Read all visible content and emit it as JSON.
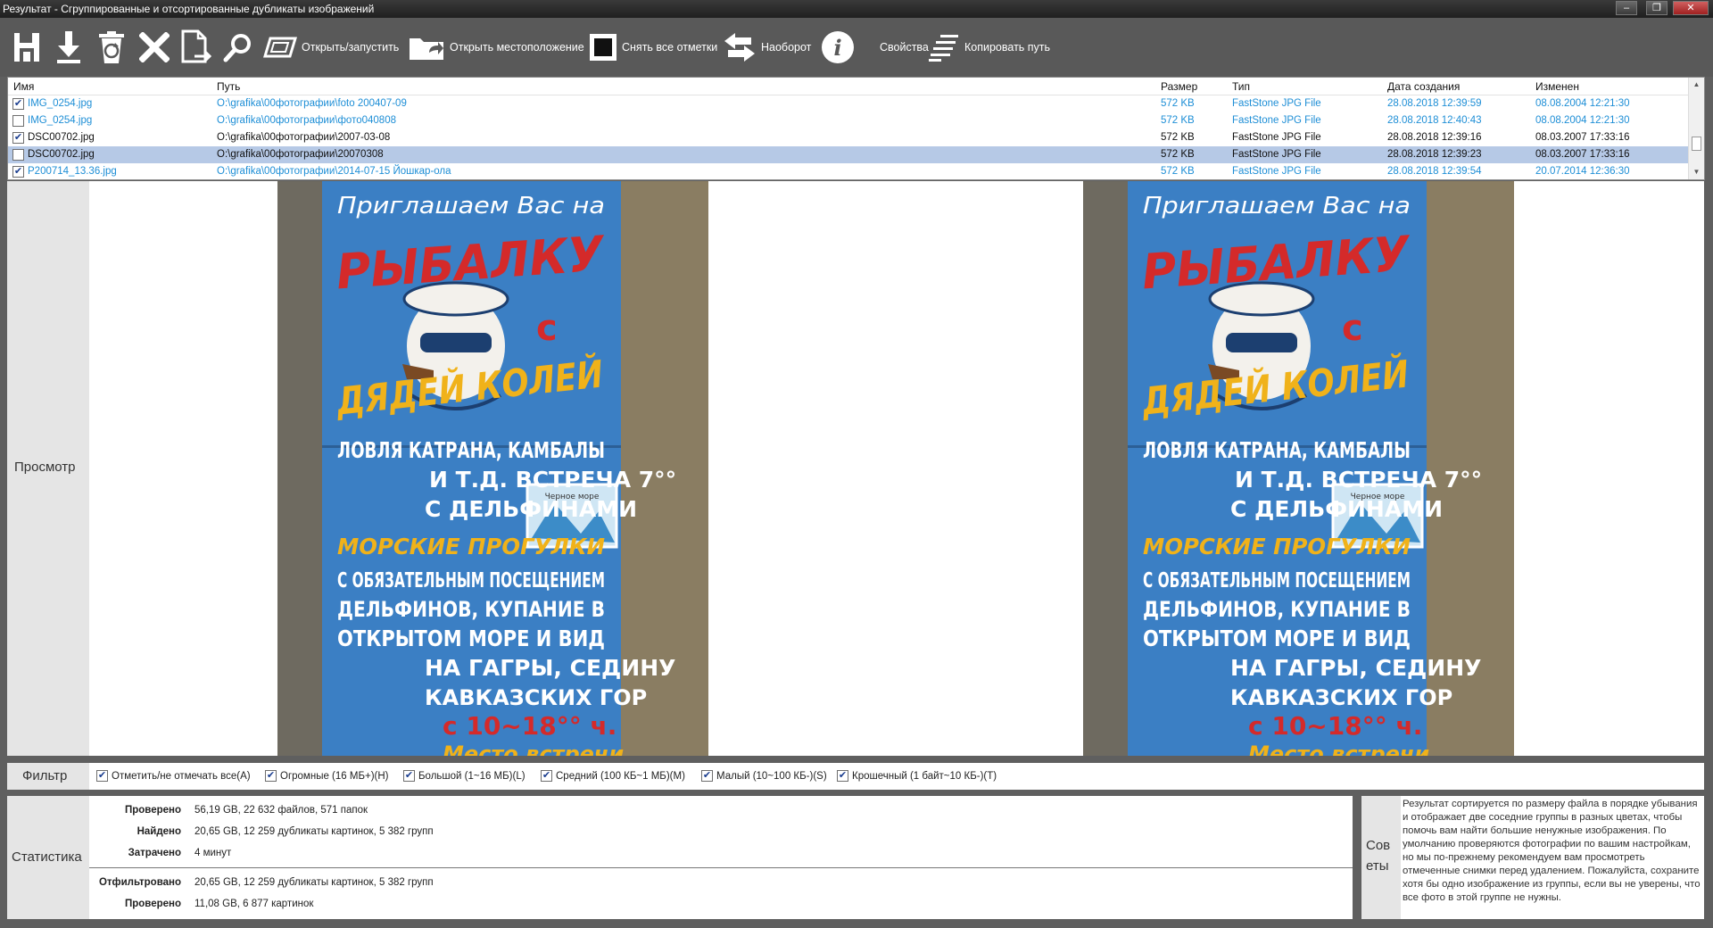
{
  "window": {
    "title": "Результат - Сгруппированные и отсортированные дубликаты изображений",
    "controls": [
      "‒",
      "❐",
      "✕"
    ]
  },
  "toolbar": {
    "buttons": [
      {
        "icon": "save-icon",
        "label": ""
      },
      {
        "icon": "download-icon",
        "label": ""
      },
      {
        "icon": "recycle-bin-icon",
        "label": ""
      },
      {
        "icon": "delete-x-icon",
        "label": ""
      },
      {
        "icon": "move-file-icon",
        "label": ""
      },
      {
        "icon": "search-icon",
        "label": ""
      },
      {
        "icon": "open-run-icon",
        "label": "Открыть/запустить"
      },
      {
        "icon": "folder-open-icon",
        "label": "Открыть местоположение"
      },
      {
        "icon": "uncheck-all-icon",
        "label": "Снять все отметки"
      },
      {
        "icon": "invert-arrows-icon",
        "label": "Наоборот"
      },
      {
        "icon": "info-icon",
        "label": "Свойства"
      },
      {
        "icon": "copy-path-icon",
        "label": "Копировать путь"
      }
    ]
  },
  "table": {
    "columns": [
      "Имя",
      "Путь",
      "Размер",
      "Тип",
      "Дата создания",
      "Изменен"
    ],
    "rows": [
      {
        "checked": true,
        "style": "blue",
        "selected": false,
        "name": "IMG_0254.jpg",
        "path": "O:\\grafika\\00фотографии\\foto 200407-09",
        "size": "572 KB",
        "type": "FastStone JPG File",
        "created": "28.08.2018 12:39:59",
        "modified": "08.08.2004 12:21:30"
      },
      {
        "checked": false,
        "style": "blue",
        "selected": false,
        "name": "IMG_0254.jpg",
        "path": "O:\\grafika\\00фотографии\\фото040808",
        "size": "572 KB",
        "type": "FastStone JPG File",
        "created": "28.08.2018 12:40:43",
        "modified": "08.08.2004 12:21:30"
      },
      {
        "checked": true,
        "style": "black",
        "selected": false,
        "name": "DSC00702.jpg",
        "path": "O:\\grafika\\00фотографии\\2007-03-08",
        "size": "572 KB",
        "type": "FastStone JPG File",
        "created": "28.08.2018 12:39:16",
        "modified": "08.03.2007 17:33:16"
      },
      {
        "checked": false,
        "style": "black",
        "selected": true,
        "name": "DSC00702.jpg",
        "path": "O:\\grafika\\00фотографии\\20070308",
        "size": "572 KB",
        "type": "FastStone JPG File",
        "created": "28.08.2018 12:39:23",
        "modified": "08.03.2007 17:33:16"
      },
      {
        "checked": true,
        "style": "blue",
        "selected": false,
        "name": "P200714_13.36.jpg",
        "path": "O:\\grafika\\00фотографии\\2014-07-15 Йошкар-ола",
        "size": "572 KB",
        "type": "FastStone JPG File",
        "created": "28.08.2018 12:39:54",
        "modified": "20.07.2014 12:36:30"
      }
    ]
  },
  "preview": {
    "label": "Просмотр",
    "sign": {
      "line1": "Приглашаем Вас на",
      "line2": "РЫБАЛКУ",
      "line3": "с",
      "line4": "ДЯДЕЙ КОЛЕЙ",
      "line5": "ЛОВЛЯ КАТРАНА, КАМБАЛЫ",
      "line6": "И Т.Д. ВСТРЕЧА 7°°",
      "line7": "С ДЕЛЬФИНАМИ",
      "line8": "МОРСКИЕ ПРОГУЛКИ",
      "line9": "С ОБЯЗАТЕЛЬНЫМ ПОСЕЩЕНИЕМ",
      "line10": "ДЕЛЬФИНОВ, КУПАНИЕ В",
      "line11": "ОТКРЫТОМ МОРЕ И ВИД",
      "line12": "НА ГАГРЫ, СЕДИНУ",
      "line13": "КАВКАЗСКИХ ГОР",
      "line14": "с 10~18°° ч.",
      "line15": "Место встречи",
      "sticker": "Черное море"
    }
  },
  "filter": {
    "label": "Фильтр",
    "options": [
      {
        "checked": true,
        "label": "Отметить/не отмечать все(A)"
      },
      {
        "checked": true,
        "label": "Огромные (16 МБ+)(H)"
      },
      {
        "checked": true,
        "label": "Большой (1~16 МБ)(L)"
      },
      {
        "checked": true,
        "label": "Средний (100 КБ~1 МБ)(M)"
      },
      {
        "checked": true,
        "label": "Малый (10~100 КБ-)(S)"
      },
      {
        "checked": true,
        "label": "Крошечный (1 байт~10 КБ-)(T)"
      }
    ]
  },
  "stats": {
    "label": "Статистика",
    "items": [
      {
        "key": "Проверено",
        "value": "56,19 GB, 22 632 файлов, 571 папок"
      },
      {
        "key": "Найдено",
        "value": "20,65 GB, 12 259 дубликаты картинок, 5 382 групп"
      },
      {
        "key": "Затрачено",
        "value": "4 минут"
      },
      {
        "key": "Отфильтровано",
        "value": "20,65 GB, 12 259 дубликаты картинок, 5 382 групп"
      },
      {
        "key": "Проверено",
        "value": "11,08 GB, 6 877 картинок"
      }
    ]
  },
  "tips": {
    "label_line1": "Сов",
    "label_line2": "еты",
    "text": "Результат сортируется по размеру файла в порядке убывания и отображает две соседние группы в разных цветах, чтобы помочь вам найти большие ненужные изображения. По умолчанию проверяются фотографии по вашим настройкам, но мы по-прежнему рекомендуем вам просмотреть отмеченные снимки перед удалением. Пожалуйста, сохраните хотя бы одно изображение из группы, если вы не уверены, что все фото в этой группе не нужны."
  },
  "colors": {
    "link_blue": "#1d8ed6",
    "selection": "#b6c9e6",
    "toolbar_bg": "#595959",
    "sign_blue": "#3b7fc4",
    "sign_red": "#d42a2a",
    "sign_yellow": "#f0b21a"
  }
}
